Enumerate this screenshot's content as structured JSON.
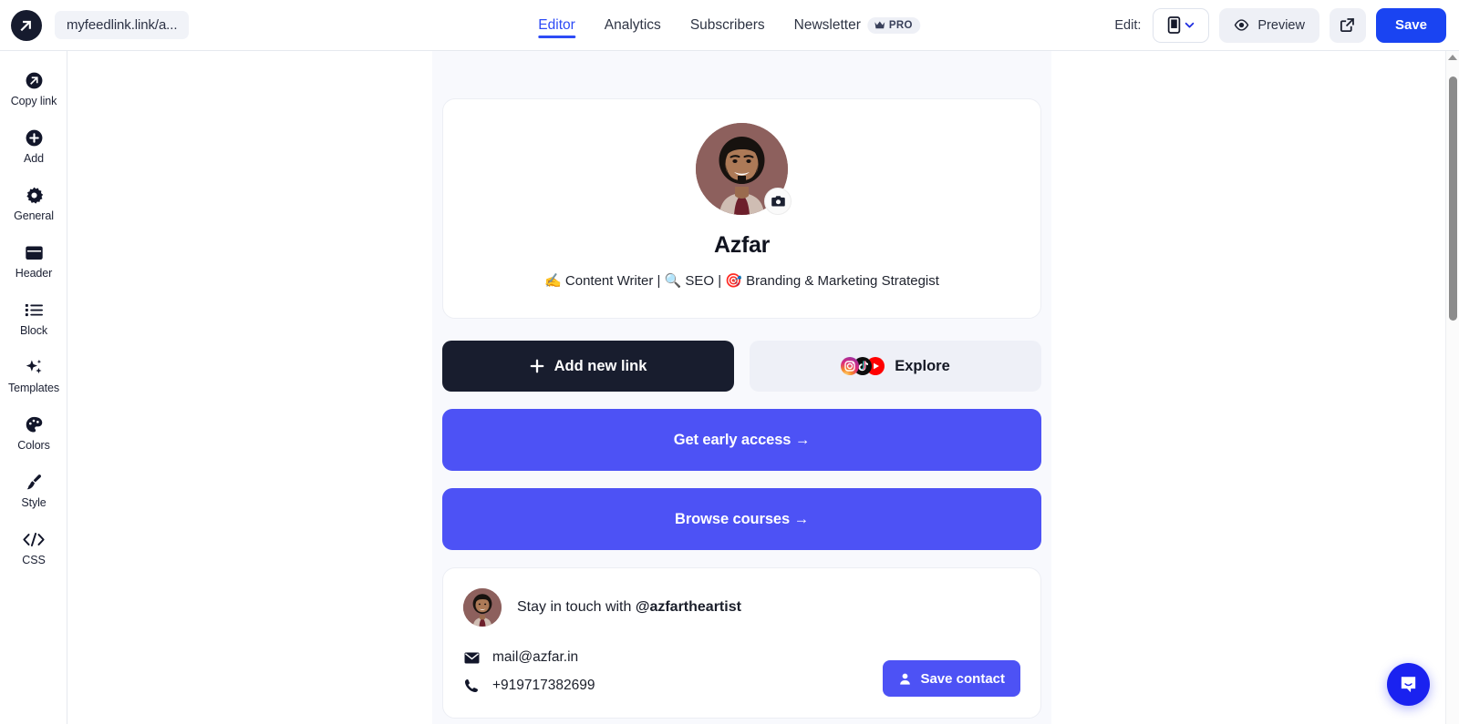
{
  "header": {
    "logo_icon": "arrow-up-right-circle-logo",
    "url_pill": "myfeedlink.link/a...",
    "tabs": [
      {
        "label": "Editor",
        "active": true
      },
      {
        "label": "Analytics",
        "active": false
      },
      {
        "label": "Subscribers",
        "active": false
      },
      {
        "label": "Newsletter",
        "active": false,
        "badge": "PRO",
        "badge_icon": "crown-icon"
      }
    ],
    "edit_label": "Edit:",
    "device_value": "mobile",
    "device_icon": "mobile-device-icon",
    "chevron_icon": "chevron-down-icon",
    "preview_label": "Preview",
    "preview_icon": "eye-icon",
    "open_external_icon": "external-link-icon",
    "save_label": "Save"
  },
  "sidebar": {
    "items": [
      {
        "label": "Copy link",
        "icon": "copy-link-icon"
      },
      {
        "label": "Add",
        "icon": "plus-circle-icon"
      },
      {
        "label": "General",
        "icon": "gear-icon"
      },
      {
        "label": "Header",
        "icon": "header-layout-icon"
      },
      {
        "label": "Block",
        "icon": "list-icon"
      },
      {
        "label": "Templates",
        "icon": "sparkles-icon"
      },
      {
        "label": "Colors",
        "icon": "palette-icon"
      },
      {
        "label": "Style",
        "icon": "paintbrush-icon"
      },
      {
        "label": "CSS",
        "icon": "code-icon"
      }
    ]
  },
  "preview": {
    "profile": {
      "avatar_alt": "profile-photo",
      "avatar_bg": "#8d605d",
      "camera_icon": "camera-icon",
      "name": "Azfar",
      "bio_parts": [
        {
          "emoji": "✍️",
          "text": "Content Writer"
        },
        {
          "emoji": "🔍",
          "text": "SEO"
        },
        {
          "emoji": "🎯",
          "text": "Branding & Marketing Strategist"
        }
      ],
      "bio": "✍️ Content Writer | 🔍 SEO | 🎯 Branding & Marketing Strategist"
    },
    "actions": {
      "add_link_label": "Add new link",
      "add_link_icon": "plus-icon",
      "explore_label": "Explore",
      "explore_icons": [
        "instagram-icon",
        "tiktok-icon",
        "youtube-icon"
      ]
    },
    "links": [
      {
        "label": "Get early access →"
      },
      {
        "label": "Browse courses →"
      }
    ],
    "contact": {
      "heading_prefix": "Stay in touch with ",
      "handle": "@azfartheartist",
      "email": "mail@azfar.in",
      "email_icon": "envelope-icon",
      "phone": "+919717382699",
      "phone_icon": "phone-icon",
      "save_contact_label": "Save contact",
      "save_contact_icon": "person-icon"
    }
  },
  "chat": {
    "icon": "intercom-chat-icon"
  },
  "scrollbar": {
    "up_arrow_icon": "scroll-up-arrow-icon",
    "thumb": "scroll-thumb"
  },
  "colors": {
    "accent_blue": "#1a44f2",
    "tab_active": "#2d4bf6",
    "cta_purple": "#4d52f5",
    "dark": "#181d2e"
  }
}
